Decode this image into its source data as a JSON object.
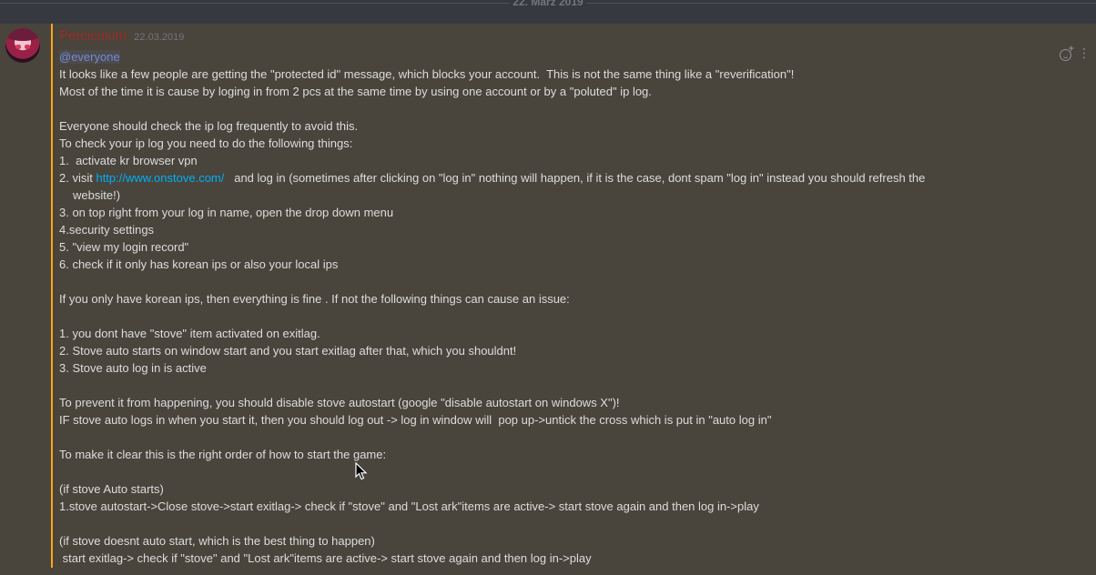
{
  "divider": {
    "date": "22. März 2019"
  },
  "message": {
    "author": "Perciculum",
    "timestamp": "22.03.2019",
    "author_color": "#992d22",
    "accent_color": "#faa61a",
    "mention": "@everyone",
    "lines": [
      "It looks like a few people are getting the \"protected id\" message, which blocks your account.  This is not the same thing like a \"reverification\"!",
      "Most of the time it is cause by loging in from 2 pcs at the same time by using one account or by a \"poluted\" ip log.",
      "",
      "Everyone should check the ip log frequently to avoid this.",
      "To check your ip log you need to do the following things:",
      "1.  activate kr browser vpn"
    ],
    "step2": {
      "prefix": "2. visit ",
      "link": "http://www.onstove.com/",
      "suffix": "   and log in (sometimes after clicking on \"log in\" nothing will happen, if it is the case, dont spam \"log in\" instead you should refresh the",
      "continuation": "website!)"
    },
    "lines_after": [
      "3. on top right from your log in name, open the drop down menu",
      "4.security settings",
      "5. \"view my login record\"",
      "6. check if it only has korean ips or also your local ips",
      "",
      "If you only have korean ips, then everything is fine . If not the following things can cause an issue:",
      "",
      "1. you dont have \"stove\" item activated on exitlag.",
      "2. Stove auto starts on window start and you start exitlag after that, which you shouldnt!",
      "3. Stove auto log in is active",
      "",
      "To prevent it from happening, you should disable stove autostart (google \"disable autostart on windows X\")!",
      "IF stove auto logs in when you start it, then you should log out -> log in window will  pop up->untick the cross which is put in \"auto log in\"",
      "",
      "To make it clear this is the right order of how to start the game:",
      "",
      "(if stove Auto starts)",
      "1.stove autostart->Close stove->start exitlag-> check if \"stove\" and \"Lost ark\"items are active-> start stove again and then log in->play",
      "",
      "(if stove doesnt auto start, which is the best thing to happen)",
      " start exitlag-> check if \"stove\" and \"Lost ark\"items are active-> start stove again and then log in->play"
    ]
  },
  "icons": {
    "avatar": "avatar",
    "reaction": "add-reaction-icon",
    "more": "more-options-icon",
    "cursor": "mouse-cursor-icon"
  }
}
